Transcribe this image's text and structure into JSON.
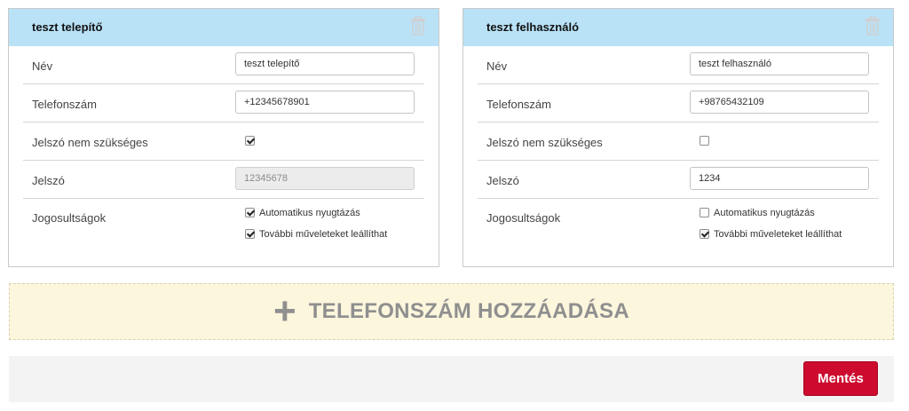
{
  "cards": [
    {
      "title": "teszt telepítő",
      "labels": {
        "name": "Név",
        "phone": "Telefonszám",
        "no_password": "Jelszó nem szükséges",
        "password": "Jelszó",
        "permissions": "Jogosultságok"
      },
      "name_value": "teszt telepítő",
      "phone_value": "+12345678901",
      "no_password_checked": true,
      "password_value": "12345678",
      "password_disabled": true,
      "permissions": [
        {
          "label": "Automatikus nyugtázás",
          "checked": true
        },
        {
          "label": "További műveleteket leállíthat",
          "checked": true
        }
      ]
    },
    {
      "title": "teszt felhasználó",
      "labels": {
        "name": "Név",
        "phone": "Telefonszám",
        "no_password": "Jelszó nem szükséges",
        "password": "Jelszó",
        "permissions": "Jogosultságok"
      },
      "name_value": "teszt felhasználó",
      "phone_value": "+98765432109",
      "no_password_checked": false,
      "password_value": "1234",
      "password_disabled": false,
      "permissions": [
        {
          "label": "Automatikus nyugtázás",
          "checked": false
        },
        {
          "label": "További műveleteket leállíthat",
          "checked": true
        }
      ]
    }
  ],
  "add_phone": {
    "icon": "plus-icon",
    "label": "TELEFONSZÁM HOZZÁADÁSA"
  },
  "footer": {
    "save_label": "Mentés"
  },
  "colors": {
    "header_bg": "#b9e2f7",
    "add_bar_bg": "#fcf6dd",
    "save_button": "#cc0b2e",
    "footer_bg": "#f3f3f3"
  }
}
